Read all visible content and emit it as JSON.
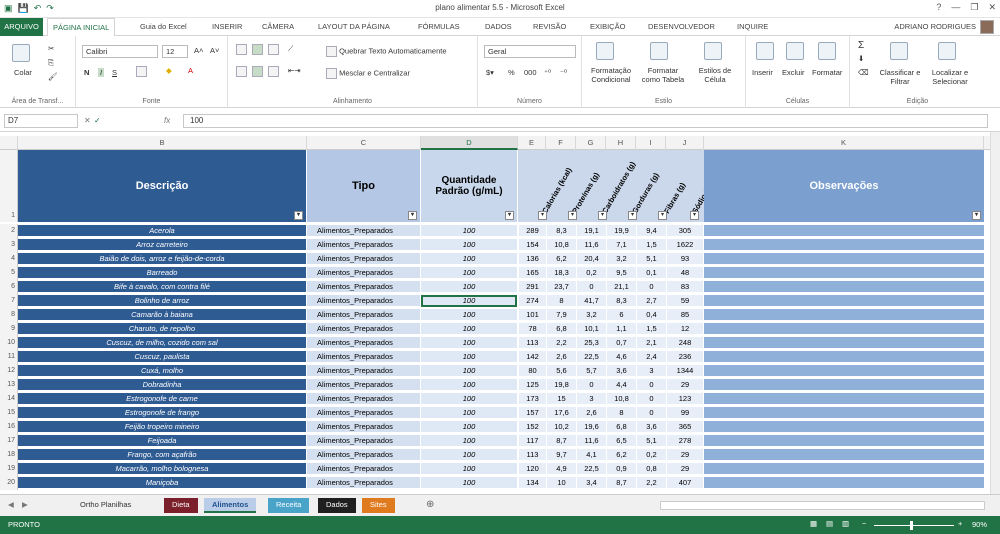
{
  "window": {
    "title": "plano alimentar 5.5 - Microsoft Excel"
  },
  "tabs": [
    {
      "label": "ARQUIVO"
    },
    {
      "label": "PÁGINA INICIAL"
    },
    {
      "label": "Guia do Excel"
    },
    {
      "label": "INSERIR"
    },
    {
      "label": "CÂMERA"
    },
    {
      "label": "LAYOUT DA PÁGINA"
    },
    {
      "label": "FÓRMULAS"
    },
    {
      "label": "DADOS"
    },
    {
      "label": "REVISÃO"
    },
    {
      "label": "EXIBIÇÃO"
    },
    {
      "label": "DESENVOLVEDOR"
    },
    {
      "label": "INQUIRE"
    }
  ],
  "user": "ADRIANO RODRIGUES",
  "ribbon": {
    "paste": "Colar",
    "clipboard": "Área de Transf...",
    "font_name": "Calibri",
    "font_size": "12",
    "font_group": "Fonte",
    "wrap_text": "Quebrar Texto Automaticamente",
    "merge_center": "Mesclar e Centralizar",
    "align_group": "Alinhamento",
    "number_format": "Geral",
    "number_group": "Número",
    "cond_format": "Formatação Condicional",
    "format_table": "Formatar como Tabela",
    "cell_styles": "Estilos de Célula",
    "styles_group": "Estilo",
    "insert": "Inserir",
    "delete": "Excluir",
    "format": "Formatar",
    "cells_group": "Células",
    "sort_filter": "Classificar e Filtrar",
    "find_select": "Localizar e Selecionar",
    "edit_group": "Edição"
  },
  "formula_bar": {
    "name_box": "D7",
    "fx": "fx",
    "value": "100"
  },
  "columns": [
    "B",
    "C",
    "D",
    "E",
    "F",
    "G",
    "H",
    "I",
    "J",
    "K"
  ],
  "headers": {
    "descricao": "Descrição",
    "tipo": "Tipo",
    "quantidade": "Quantidade Padrão (g/mL)",
    "calorias": "Calorias (kcal)",
    "proteinas": "Proteínas (g)",
    "carboidratos": "Carboidratos (g)",
    "gorduras": "Gorduras (g)",
    "fibras": "Fibras (g)",
    "sodio": "Sódio (mg)",
    "observacoes": "Observações"
  },
  "rows": [
    {
      "n": "2",
      "desc": "Acerola",
      "tipo": "Alimentos_Preparados",
      "qtd": "100",
      "e": "289",
      "f": "8,3",
      "g": "19,1",
      "h": "19,9",
      "i": "9,4",
      "j": "305"
    },
    {
      "n": "3",
      "desc": "Arroz carreteiro",
      "tipo": "Alimentos_Preparados",
      "qtd": "100",
      "e": "154",
      "f": "10,8",
      "g": "11,6",
      "h": "7,1",
      "i": "1,5",
      "j": "1622"
    },
    {
      "n": "4",
      "desc": "Baião de dois, arroz e feijão-de-corda",
      "tipo": "Alimentos_Preparados",
      "qtd": "100",
      "e": "136",
      "f": "6,2",
      "g": "20,4",
      "h": "3,2",
      "i": "5,1",
      "j": "93"
    },
    {
      "n": "5",
      "desc": "Barreado",
      "tipo": "Alimentos_Preparados",
      "qtd": "100",
      "e": "165",
      "f": "18,3",
      "g": "0,2",
      "h": "9,5",
      "i": "0,1",
      "j": "48"
    },
    {
      "n": "6",
      "desc": "Bife à cavalo, com contra filé",
      "tipo": "Alimentos_Preparados",
      "qtd": "100",
      "e": "291",
      "f": "23,7",
      "g": "0",
      "h": "21,1",
      "i": "0",
      "j": "83"
    },
    {
      "n": "7",
      "desc": "Bolinho de arroz",
      "tipo": "Alimentos_Preparados",
      "qtd": "100",
      "e": "274",
      "f": "8",
      "g": "41,7",
      "h": "8,3",
      "i": "2,7",
      "j": "59"
    },
    {
      "n": "8",
      "desc": "Camarão à baiana",
      "tipo": "Alimentos_Preparados",
      "qtd": "100",
      "e": "101",
      "f": "7,9",
      "g": "3,2",
      "h": "6",
      "i": "0,4",
      "j": "85"
    },
    {
      "n": "9",
      "desc": "Charuto, de repolho",
      "tipo": "Alimentos_Preparados",
      "qtd": "100",
      "e": "78",
      "f": "6,8",
      "g": "10,1",
      "h": "1,1",
      "i": "1,5",
      "j": "12"
    },
    {
      "n": "10",
      "desc": "Cuscuz, de milho, cozido com sal",
      "tipo": "Alimentos_Preparados",
      "qtd": "100",
      "e": "113",
      "f": "2,2",
      "g": "25,3",
      "h": "0,7",
      "i": "2,1",
      "j": "248"
    },
    {
      "n": "11",
      "desc": "Cuscuz, paulista",
      "tipo": "Alimentos_Preparados",
      "qtd": "100",
      "e": "142",
      "f": "2,6",
      "g": "22,5",
      "h": "4,6",
      "i": "2,4",
      "j": "236"
    },
    {
      "n": "12",
      "desc": "Cuxá, molho",
      "tipo": "Alimentos_Preparados",
      "qtd": "100",
      "e": "80",
      "f": "5,6",
      "g": "5,7",
      "h": "3,6",
      "i": "3",
      "j": "1344"
    },
    {
      "n": "13",
      "desc": "Dobradinha",
      "tipo": "Alimentos_Preparados",
      "qtd": "100",
      "e": "125",
      "f": "19,8",
      "g": "0",
      "h": "4,4",
      "i": "0",
      "j": "29"
    },
    {
      "n": "14",
      "desc": "Estrogonofe de carne",
      "tipo": "Alimentos_Preparados",
      "qtd": "100",
      "e": "173",
      "f": "15",
      "g": "3",
      "h": "10,8",
      "i": "0",
      "j": "123"
    },
    {
      "n": "15",
      "desc": "Estrogonofe de frango",
      "tipo": "Alimentos_Preparados",
      "qtd": "100",
      "e": "157",
      "f": "17,6",
      "g": "2,6",
      "h": "8",
      "i": "0",
      "j": "99"
    },
    {
      "n": "16",
      "desc": "Feijão tropeiro mineiro",
      "tipo": "Alimentos_Preparados",
      "qtd": "100",
      "e": "152",
      "f": "10,2",
      "g": "19,6",
      "h": "6,8",
      "i": "3,6",
      "j": "365"
    },
    {
      "n": "17",
      "desc": "Feijoada",
      "tipo": "Alimentos_Preparados",
      "qtd": "100",
      "e": "117",
      "f": "8,7",
      "g": "11,6",
      "h": "6,5",
      "i": "5,1",
      "j": "278"
    },
    {
      "n": "18",
      "desc": "Frango, com açafrão",
      "tipo": "Alimentos_Preparados",
      "qtd": "100",
      "e": "113",
      "f": "9,7",
      "g": "4,1",
      "h": "6,2",
      "i": "0,2",
      "j": "29"
    },
    {
      "n": "19",
      "desc": "Macarrão, molho bolognesa",
      "tipo": "Alimentos_Preparados",
      "qtd": "100",
      "e": "120",
      "f": "4,9",
      "g": "22,5",
      "h": "0,9",
      "i": "0,8",
      "j": "29"
    },
    {
      "n": "20",
      "desc": "Maniçoba",
      "tipo": "Alimentos_Preparados",
      "qtd": "100",
      "e": "134",
      "f": "10",
      "g": "3,4",
      "h": "8,7",
      "i": "2,2",
      "j": "407"
    }
  ],
  "sheet_tabs": [
    {
      "label": "Ortho Planilhas",
      "color": "#f0f0f0",
      "text": "#333"
    },
    {
      "label": "Dieta",
      "color": "#7b1f2a",
      "text": "#fff"
    },
    {
      "label": "Alimentos",
      "color": "#b9cde8",
      "text": "#1f4f8a"
    },
    {
      "label": "Receita",
      "color": "#4aa3c8",
      "text": "#fff"
    },
    {
      "label": "Dados",
      "color": "#1f1f1f",
      "text": "#fff"
    },
    {
      "label": "Sites",
      "color": "#e07a1f",
      "text": "#fff"
    }
  ],
  "status": {
    "ready": "PRONTO",
    "zoom": "90%"
  }
}
